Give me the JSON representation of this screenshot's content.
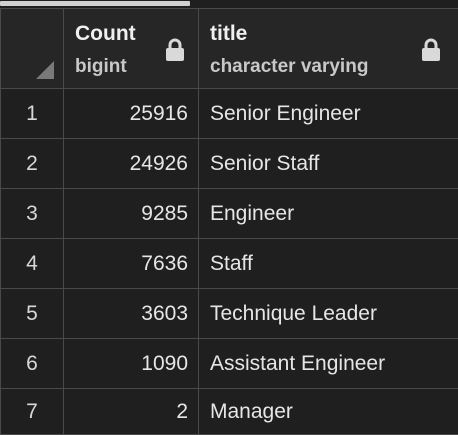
{
  "columns": [
    {
      "name": "Count",
      "type": "bigint"
    },
    {
      "name": "title",
      "type": "character varying"
    }
  ],
  "rows": [
    {
      "n": "1",
      "count": "25916",
      "title": "Senior Engineer"
    },
    {
      "n": "2",
      "count": "24926",
      "title": "Senior Staff"
    },
    {
      "n": "3",
      "count": "9285",
      "title": "Engineer"
    },
    {
      "n": "4",
      "count": "7636",
      "title": "Staff"
    },
    {
      "n": "5",
      "count": "3603",
      "title": "Technique Leader"
    },
    {
      "n": "6",
      "count": "1090",
      "title": "Assistant Engineer"
    },
    {
      "n": "7",
      "count": "2",
      "title": "Manager"
    }
  ],
  "icons": {
    "lock": "lock-icon",
    "corner": "select-all-corner-icon"
  },
  "colors": {
    "background": "#1f1f1f",
    "header": "#262626",
    "border": "#4a4a4a",
    "text": "#e6e6e6"
  }
}
